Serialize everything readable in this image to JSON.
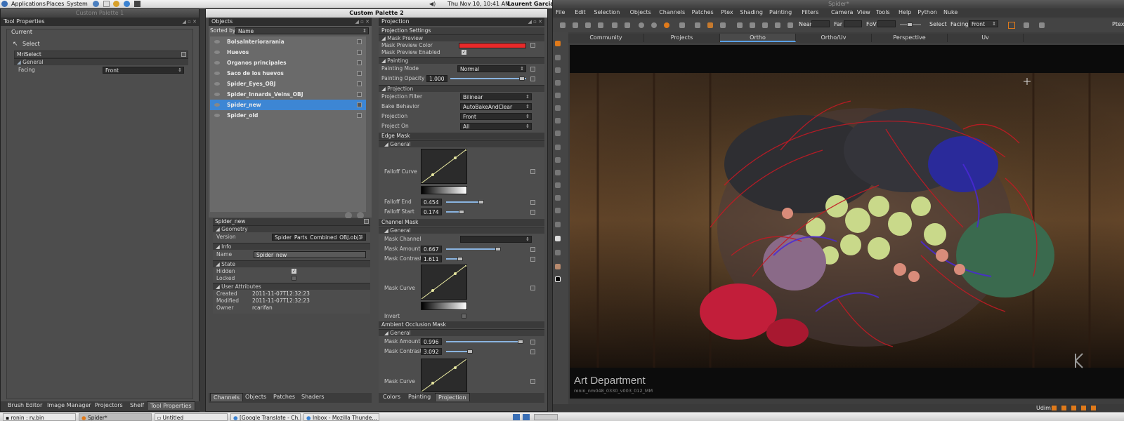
{
  "system_bar": {
    "menus": [
      "Applications",
      "Places",
      "System"
    ],
    "clock": "Thu Nov 10, 10:41 AM",
    "user": "Laurent Garcia"
  },
  "left_window": {
    "title": "Custom Palette 1",
    "panel_title": "Tool Properties",
    "current_label": "Current",
    "tool_name": "Select",
    "group_title": "MriSelect",
    "section_general": "General",
    "facing_label": "Facing",
    "facing_value": "Front",
    "bottom_tabs": [
      "Brush Editor",
      "Image Manager",
      "Projectors",
      "Shelf",
      "Tool Properties"
    ]
  },
  "center_window": {
    "title": "Custom Palette 2",
    "objects_panel": {
      "title": "Objects",
      "sorted_by_label": "Sorted by",
      "sorted_by_value": "Name",
      "items": [
        "BolsaInteriorarania",
        "Huevos",
        "Organos principales",
        "Saco de los huevos",
        "Spider_Eyes_OBJ",
        "Spider_Innards_Veins_OBJ",
        "Spider_new",
        "Spider_old"
      ],
      "selected_index": 6
    },
    "object_props": {
      "title": "Spider_new",
      "geometry_section": "Geometry",
      "version_label": "Version",
      "version_value": "Spider_Parts_Combined_OBJ.obj1",
      "info_section": "Info",
      "name_label": "Name",
      "name_value": "Spider_new",
      "state_section": "State",
      "hidden_label": "Hidden",
      "locked_label": "Locked",
      "user_attr_section": "User Attributes",
      "created_label": "Created",
      "created_value": "2011-11-07T12:32:23",
      "modified_label": "Modified",
      "modified_value": "2011-11-07T12:32:23",
      "owner_label": "Owner",
      "owner_value": "rcarifan"
    },
    "bottom_tabs_left": [
      "Channels",
      "Objects",
      "Patches",
      "Shaders"
    ],
    "projection_panel": {
      "title": "Projection",
      "settings_title": "Projection Settings",
      "mask_preview_section": "Mask Preview",
      "mask_preview_color_label": "Mask Preview Color",
      "mask_preview_color": "#e82a2a",
      "mask_preview_enabled_label": "Mask Preview Enabled",
      "painting_section": "Painting",
      "painting_mode_label": "Painting Mode",
      "painting_mode_value": "Normal",
      "painting_opacity_label": "Painting Opacity",
      "painting_opacity_value": "1.000",
      "projection_section": "Projection",
      "projection_filter_label": "Projection Filter",
      "projection_filter_value": "Bilinear",
      "bake_behavior_label": "Bake Behavior",
      "bake_behavior_value": "AutoBakeAndClear",
      "projection_label": "Projection",
      "projection_value": "Front",
      "project_on_label": "Project On",
      "project_on_value": "All",
      "edge_mask_section": "Edge Mask",
      "general_label": "General",
      "falloff_curve_label": "Falloff Curve",
      "falloff_end_label": "Falloff End",
      "falloff_end_value": "0.454",
      "falloff_start_label": "Falloff Start",
      "falloff_start_value": "0.174",
      "channel_mask_section": "Channel Mask",
      "mask_channel_label": "Mask Channel",
      "mask_amount_label": "Mask Amount",
      "mask_amount_value": "0.667",
      "mask_contrast_label": "Mask Contrast",
      "mask_contrast_value": "1.611",
      "mask_curve_label": "Mask Curve",
      "invert_label": "Invert",
      "ao_mask_section": "Ambient Occlusion Mask",
      "ao_mask_amount_value": "0.996",
      "ao_mask_contrast_value": "3.092"
    },
    "bottom_tabs_right": [
      "Colors",
      "Painting",
      "Projection"
    ]
  },
  "viewer_window": {
    "title": "Spider*",
    "menus": [
      "File",
      "Edit",
      "Selection",
      "Objects",
      "Channels",
      "Patches",
      "Ptex",
      "Shading",
      "Painting",
      "Filters",
      "Camera",
      "View",
      "Tools",
      "Help",
      "Python",
      "Nuke"
    ],
    "toolbar": {
      "near_label": "Near",
      "far_label": "Far",
      "fov_label": "FoV",
      "select_label": "Select",
      "facing_label": "Facing",
      "facing_value": "Front",
      "ptex_label": "Ptex"
    },
    "view_tabs": [
      "Community",
      "Projects",
      "Ortho",
      "Ortho/Uv",
      "Perspective",
      "Uv"
    ],
    "active_view_tab": 2,
    "watermark_title": "Art Department",
    "watermark_sub": "ronin_nm048_0330_v003_012_MM",
    "status_udim": "Udim:"
  },
  "taskbar": {
    "items": [
      "ronin : rv.bin",
      "Spider*",
      "Untitled",
      "[Google Translate - Ch...",
      "Inbox - Mozilla Thunde..."
    ]
  }
}
